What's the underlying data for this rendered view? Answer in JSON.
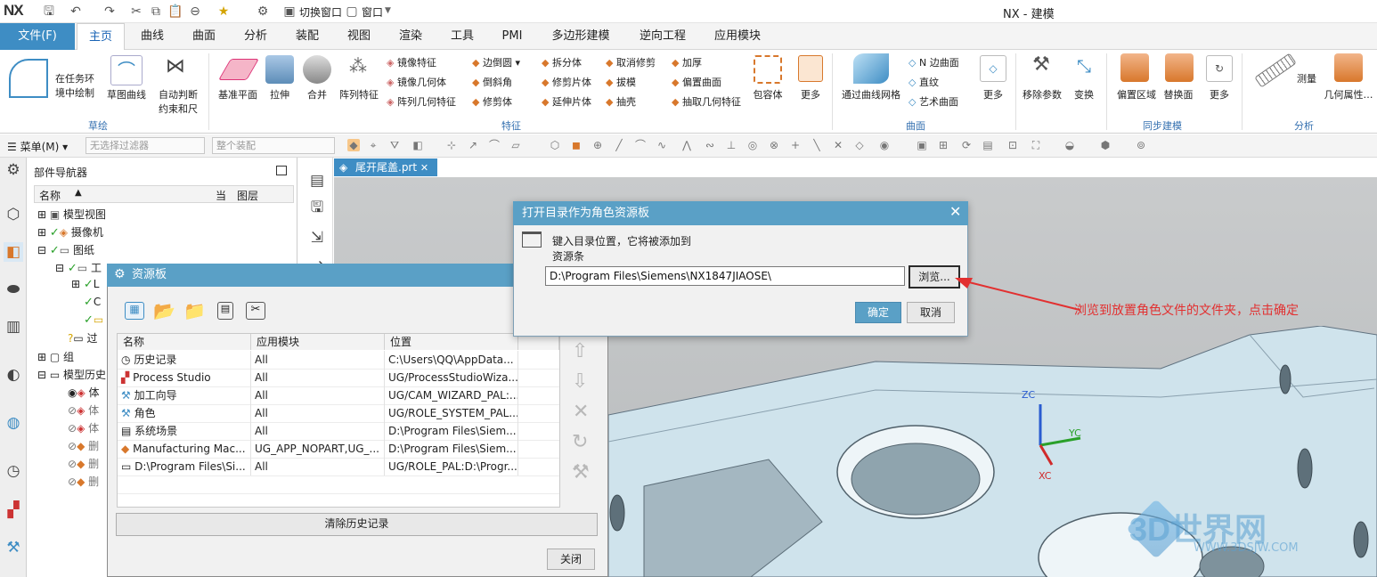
{
  "app": {
    "logo": "NX",
    "title": "NX - 建模"
  },
  "quick_access": {
    "switch_window": "切换窗口",
    "window": "窗口"
  },
  "ribbon_tabs": [
    "文件(F)",
    "主页",
    "曲线",
    "曲面",
    "分析",
    "装配",
    "视图",
    "渲染",
    "工具",
    "PMI",
    "多边形建模",
    "逆向工程",
    "应用模块"
  ],
  "ribbon": {
    "sketch": {
      "label_1": "在任务环",
      "label_2": "境中绘制",
      "curve": "草图曲线",
      "auto_1": "自动判断",
      "auto_2": "约束和尺",
      "group": "草绘"
    },
    "feature": {
      "datum": "基准平面",
      "extrude": "拉伸",
      "unite": "合并",
      "pattern": "阵列特征",
      "mirror_feature": "镜像特征",
      "mirror_body": "镜像几何体",
      "pattern_geom": "阵列几何特征",
      "edge_blend": "边倒圆",
      "chamfer": "倒斜角",
      "trim_body": "修剪体",
      "split_body": "拆分体",
      "trim_sheet": "修剪片体",
      "extend_sheet": "延伸片体",
      "untrim": "取消修剪",
      "draft": "拔模",
      "shell": "抽壳",
      "thicken": "加厚",
      "offset_face": "偏置曲面",
      "extract_geom": "抽取几何特征",
      "wrap": "包容体",
      "more": "更多",
      "group": "特征"
    },
    "surface": {
      "through_curves": "通过曲线网格",
      "n_sided": "N 边曲面",
      "ruled": "直纹",
      "studio": "艺术曲面",
      "more": "更多",
      "group": "曲面"
    },
    "sync": {
      "remove_param": "移除参数",
      "transform": "变换",
      "offset_region": "偏置区域",
      "replace_face": "替换面",
      "more": "更多",
      "group": "同步建模"
    },
    "analysis": {
      "measure": "测量",
      "geom_props": "几何属性…",
      "group": "分析"
    }
  },
  "filter_bar": {
    "menu": "菜单(M)",
    "filter_placeholder": "无选择过滤器",
    "assembly_placeholder": "整个装配"
  },
  "navigator": {
    "title": "部件导航器",
    "columns": [
      "名称",
      "当",
      "图层"
    ],
    "items": [
      "模型视图",
      "摄像机",
      "图纸",
      "工",
      "L",
      "C",
      "过",
      "组",
      "模型历史",
      "体",
      "体",
      "体",
      "删",
      "删",
      "删"
    ]
  },
  "doc_tab": {
    "name": "尾开尾盖.prt"
  },
  "resource_panel": {
    "title": "资源板",
    "columns": [
      "名称",
      "应用模块",
      "位置"
    ],
    "rows": [
      {
        "name": "历史记录",
        "module": "All",
        "location": "C:\\Users\\QQ\\AppData..."
      },
      {
        "name": "Process Studio",
        "module": "All",
        "location": "UG/ProcessStudioWiza..."
      },
      {
        "name": "加工向导",
        "module": "All",
        "location": "UG/CAM_WIZARD_PAL:..."
      },
      {
        "name": "角色",
        "module": "All",
        "location": "UG/ROLE_SYSTEM_PAL..."
      },
      {
        "name": "系统场景",
        "module": "All",
        "location": "D:\\Program Files\\Siem..."
      },
      {
        "name": "Manufacturing Mac...",
        "module": "UG_APP_NOPART,UG_...",
        "location": "D:\\Program Files\\Siem..."
      },
      {
        "name": "D:\\Program Files\\Si...",
        "module": "All",
        "location": "UG/ROLE_PAL:D:\\Progr..."
      }
    ],
    "clear_history": "清除历史记录",
    "close": "关闭"
  },
  "open_dir_dialog": {
    "title": "打开目录作为角色资源板",
    "prompt_1": "键入目录位置，它将被添加到",
    "prompt_2": "资源条",
    "path": "D:\\Program Files\\Siemens\\NX1847JIAOSE\\",
    "browse": "浏览...",
    "ok": "确定",
    "cancel": "取消"
  },
  "annotation": "浏览到放置角色文件的文件夹，点击确定",
  "axes": {
    "zc": "ZC",
    "xc": "XC",
    "yc": "YC"
  },
  "watermark": {
    "brand": "3D世界网",
    "url": "WWW.3DSJW.COM"
  },
  "colors": {
    "accent": "#3e8dc4",
    "dialog_title": "#5aa0c6",
    "annotation": "#e23030"
  }
}
